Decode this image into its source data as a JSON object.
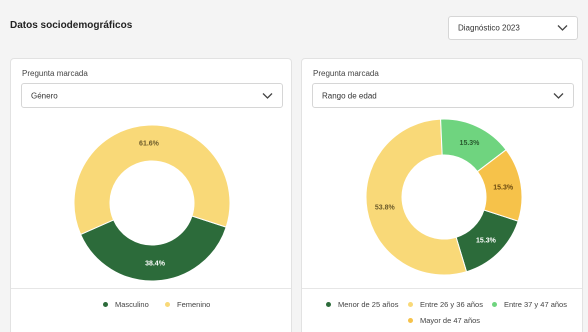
{
  "header": {
    "title": "Datos sociodemográficos",
    "year_select": "Diagnóstico 2023"
  },
  "colors": {
    "dark_green": "#2c6b3a",
    "yellow": "#f9d978",
    "light_green": "#6fd47f",
    "amber": "#f6c24a"
  },
  "left_card": {
    "label": "Pregunta marcada",
    "select_value": "Género",
    "chart_data": {
      "type": "pie",
      "donut": true,
      "slices": [
        {
          "name": "Masculino",
          "value": 38.4,
          "label": "38.4%",
          "color": "#2c6b3a",
          "label_color": "#ffffff"
        },
        {
          "name": "Femenino",
          "value": 61.6,
          "label": "61.6%",
          "color": "#f9d978",
          "label_color": "#6b5a2a"
        }
      ]
    }
  },
  "right_card": {
    "label": "Pregunta marcada",
    "select_value": "Rango de edad",
    "chart_data": {
      "type": "pie",
      "donut": true,
      "slices": [
        {
          "name": "Menor de 25 años",
          "value": 15.3,
          "label": "15.3%",
          "color": "#2c6b3a",
          "label_color": "#ffffff"
        },
        {
          "name": "Entre 26 y 36 años",
          "value": 53.8,
          "label": "53.8%",
          "color": "#f9d978",
          "label_color": "#6b5a2a"
        },
        {
          "name": "Entre 37 y 47 años",
          "value": 15.3,
          "label": "15.3%",
          "color": "#6fd47f",
          "label_color": "#2a5a2f"
        },
        {
          "name": "Mayor de 47 años",
          "value": 15.3,
          "label": "15.3%",
          "color": "#f6c24a",
          "label_color": "#6b4a10"
        }
      ]
    }
  }
}
